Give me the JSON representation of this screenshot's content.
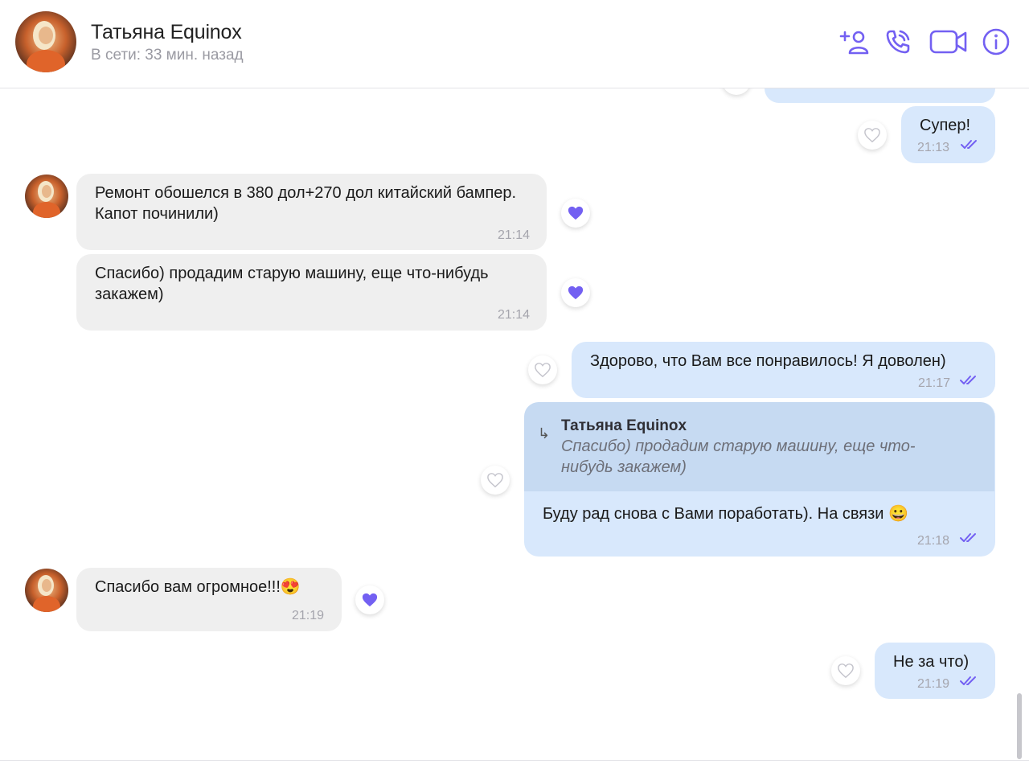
{
  "contact": {
    "name": "Татьяна Equinox",
    "status": "В сети: 33 мин. назад"
  },
  "colors": {
    "accent": "#7360f2",
    "incoming_bubble": "#efefef",
    "outgoing_bubble": "#d8e8fc",
    "reply_quote": "#c6daf2"
  },
  "icons": {
    "add_contact": "add-contact-icon",
    "call": "phone-icon",
    "video": "video-camera-icon",
    "info": "info-icon",
    "read": "double-check-icon",
    "like": "heart-icon"
  },
  "messages": [
    {
      "dir": "out",
      "text": "Супер!",
      "time": "21:13",
      "liked": false
    },
    {
      "dir": "in",
      "text": "Ремонт обошелся в 380 дол+270 дол китайский бампер. Капот починили)",
      "time": "21:14",
      "liked": true
    },
    {
      "dir": "in",
      "text": "Спасибо) продадим старую машину, еще что-нибудь закажем)",
      "time": "21:14",
      "liked": true
    },
    {
      "dir": "out",
      "text": "Здорово, что Вам все понравилось! Я доволен)",
      "time": "21:17",
      "liked": false
    },
    {
      "dir": "out",
      "reply_to": {
        "name": "Татьяна Equinox",
        "text": "Спасибо) продадим старую машину, еще что-нибудь закажем)"
      },
      "text": "Буду рад снова с Вами поработать). На связи 😀",
      "time": "21:18",
      "liked": false
    },
    {
      "dir": "in",
      "text": "Спасибо вам огромное!!!😍",
      "time": "21:19",
      "liked": true
    },
    {
      "dir": "out",
      "text": "Не за что)",
      "time": "21:19",
      "liked": false
    }
  ]
}
